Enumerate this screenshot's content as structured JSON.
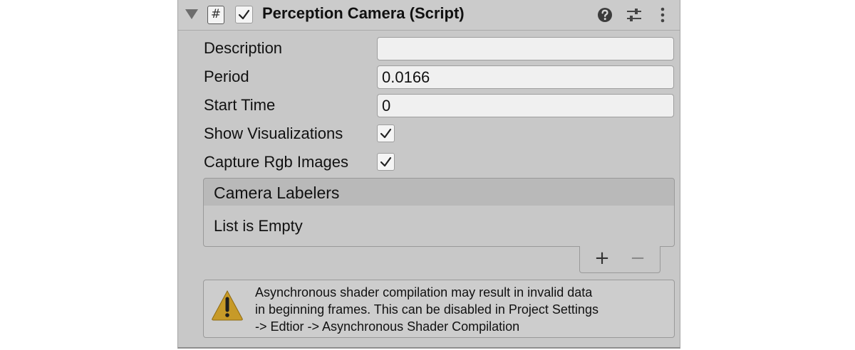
{
  "component": {
    "title": "Perception Camera (Script)",
    "script_icon_glyph": "#",
    "enabled": true
  },
  "fields": {
    "description": {
      "label": "Description",
      "value": ""
    },
    "period": {
      "label": "Period",
      "value": "0.0166"
    },
    "start_time": {
      "label": "Start Time",
      "value": "0"
    },
    "show_visualizations": {
      "label": "Show Visualizations",
      "checked": true
    },
    "capture_rgb_images": {
      "label": "Capture Rgb Images",
      "checked": true
    }
  },
  "camera_labelers": {
    "header": "Camera Labelers",
    "empty_text": "List is Empty",
    "add_glyph": "+",
    "remove_glyph": "−"
  },
  "warning": {
    "lines": [
      "Asynchronous shader compilation may result in invalid data",
      "in beginning frames. This can be disabled in Project Settings",
      "-> Edtior -> Asynchronous Shader Compilation"
    ],
    "icon": "warning-triangle-icon",
    "icon_color": "#c79a28"
  },
  "icons": {
    "foldout": "foldout-triangle-icon",
    "script": "script-icon",
    "help": "help-icon",
    "presets": "presets-sliders-icon",
    "menu": "kebab-menu-icon"
  }
}
